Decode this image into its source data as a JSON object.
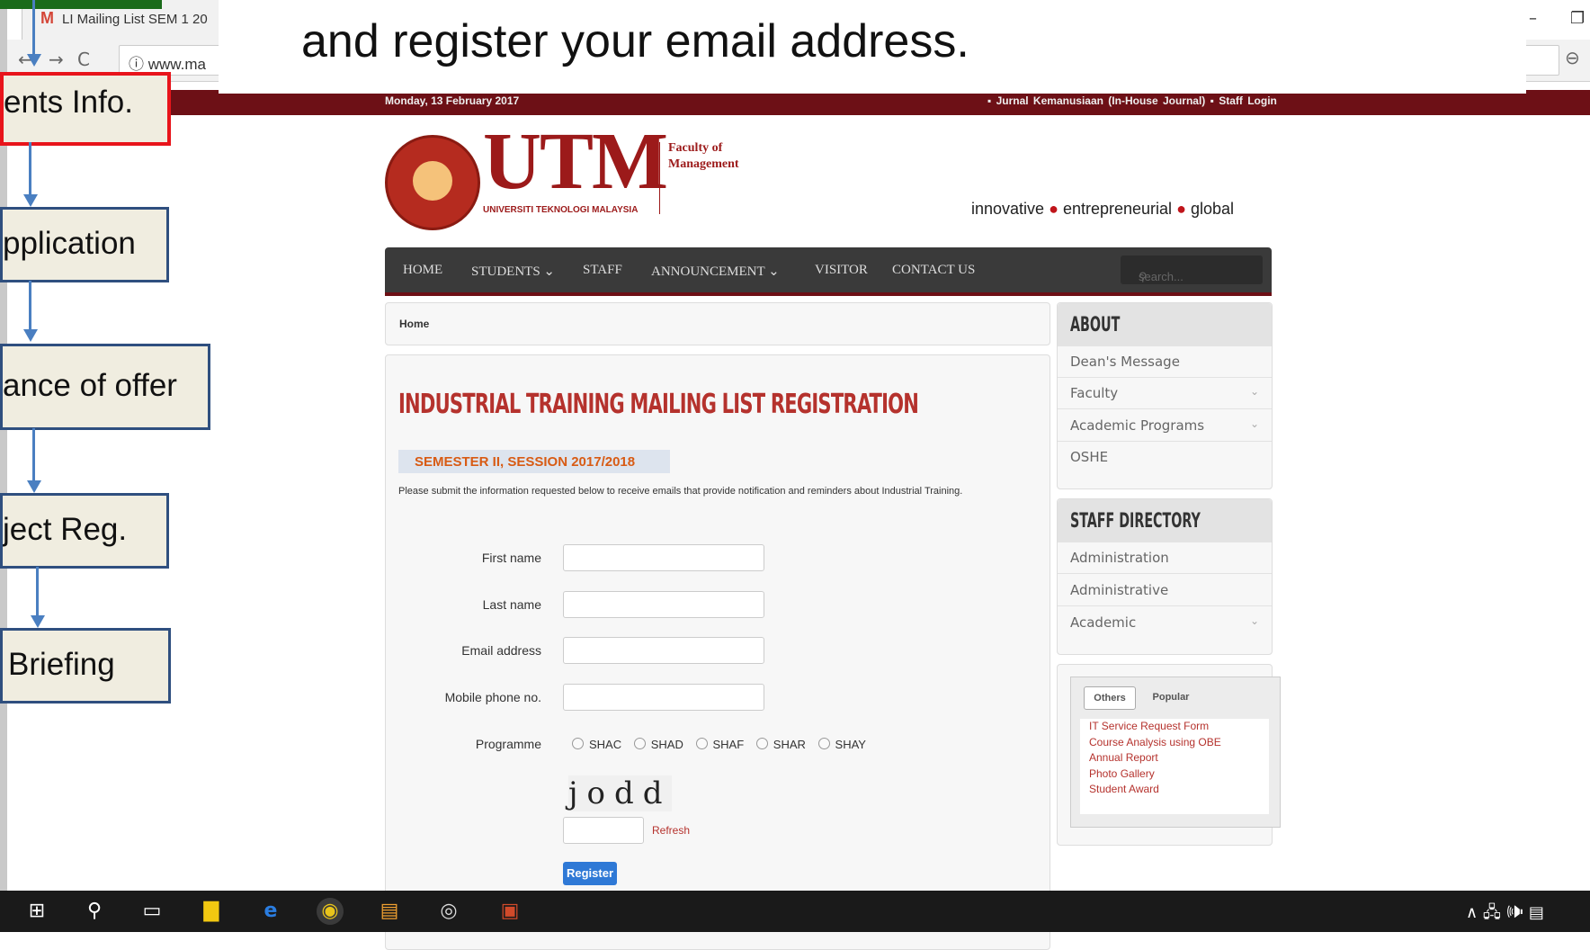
{
  "browser": {
    "tab_title": "LI Mailing List SEM 1 20",
    "url": "www.ma",
    "info_icon": "info-icon",
    "minimize": "–",
    "restore": "❐"
  },
  "overlay": {
    "text": "and register your email address."
  },
  "site": {
    "date": "Monday, 13 February 2017",
    "top_links": "▪ Jurnal Kemanusiaan (In-House Journal)    ▪ Staff Login",
    "logo": {
      "name": "UTM",
      "sub": "UNIVERSITI TEKNOLOGI MALAYSIA",
      "faculty": "Faculty of Management"
    },
    "tagline": {
      "p1": "innovative",
      "p2": "entrepreneurial",
      "p3": "global"
    },
    "menu": {
      "home": "HOME",
      "students": "STUDENTS ⌄",
      "staff": "STAFF",
      "announcement": "ANNOUNCEMENT ⌄",
      "visitor": "VISITOR",
      "contact": "CONTACT US",
      "search_placeholder": "search..."
    },
    "breadcrumb": "Home",
    "heading": "INDUSTRIAL TRAINING MAILING LIST REGISTRATION",
    "semester": "SEMESTER II, SESSION 2017/2018",
    "description": "Please submit the information requested below to receive emails that provide notification and reminders about Industrial Training.",
    "form": {
      "first_name": "First name",
      "last_name": "Last name",
      "email": "Email address",
      "mobile": "Mobile phone no.",
      "programme": "Programme",
      "programmes": [
        "SHAC",
        "SHAD",
        "SHAF",
        "SHAR",
        "SHAY"
      ],
      "captcha": "jodd",
      "refresh": "Refresh",
      "register": "Register"
    },
    "sidebar": {
      "about_title": "ABOUT",
      "about_items": [
        "Dean's Message",
        "Faculty",
        "Academic Programs",
        "OSHE"
      ],
      "staff_title": "STAFF DIRECTORY",
      "staff_items": [
        "Administration",
        "Administrative",
        "Academic"
      ],
      "tabs": [
        "Others",
        "Popular"
      ],
      "links": [
        "IT Service Request Form",
        "Course Analysis using OBE",
        "Annual Report",
        "Photo Gallery",
        "Student Award"
      ]
    }
  },
  "flowchart": {
    "items": [
      "ents Info.",
      "pplication",
      "ance of offer",
      "ject Reg.",
      "Briefing"
    ]
  },
  "taskbar": {
    "tray": "∧ 🖧 🕪 ▤"
  }
}
